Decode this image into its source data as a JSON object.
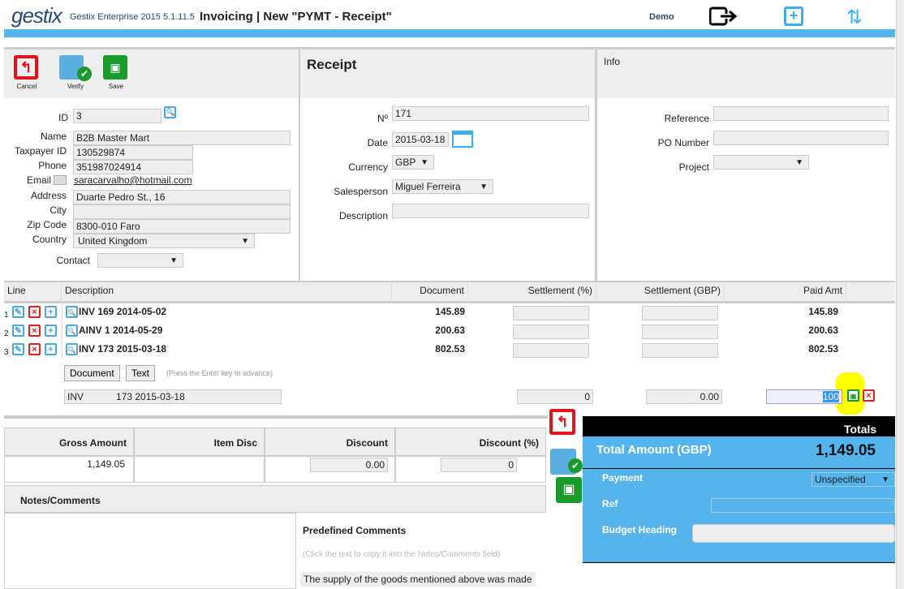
{
  "header": {
    "logo": "gestix",
    "app": "Gestix Enterprise 2015 5.1.11.5",
    "title": "Invoicing | New \"PYMT - Receipt\"",
    "user": "Demo"
  },
  "toolbar": {
    "cancel": "Cancel",
    "verify": "Verify",
    "save": "Save"
  },
  "customer": {
    "id_label": "ID",
    "id": "3",
    "name_label": "Name",
    "name": "B2B Master Mart",
    "tax_label": "Taxpayer ID",
    "tax": "130529874",
    "phone_label": "Phone",
    "phone": "351987024914",
    "email_label": "Email",
    "email": "saracarvalho@hotmail.com",
    "address_label": "Address",
    "address": "Duarte Pedro St., 16",
    "city_label": "City",
    "city": "",
    "zip_label": "Zip Code",
    "zip": "8300-010 Faro",
    "country_label": "Country",
    "country": "United Kingdom",
    "contact_label": "Contact",
    "contact": ""
  },
  "receipt": {
    "title": "Receipt",
    "no_label": "Nº",
    "no": "171",
    "date_label": "Date",
    "date": "2015-03-18",
    "currency_label": "Currency",
    "currency": "GBP",
    "salesperson_label": "Salesperson",
    "salesperson": "Miguel Ferreira",
    "description_label": "Description",
    "description": ""
  },
  "info": {
    "title": "Info",
    "reference_label": "Reference",
    "reference": "",
    "po_label": "PO Number",
    "po": "",
    "project_label": "Project",
    "project": ""
  },
  "lines": {
    "headers": [
      "Line",
      "Description",
      "Document",
      "Settlement (%)",
      "Settlement (GBP)",
      "Paid Amt"
    ],
    "rows": [
      {
        "n": "1",
        "desc": "INV 169 2014-05-02",
        "doc": "145.89",
        "paid": "145.89"
      },
      {
        "n": "2",
        "desc": "AINV 1 2014-05-29",
        "doc": "200.63",
        "paid": "200.63"
      },
      {
        "n": "3",
        "desc": "INV 173 2015-03-18",
        "doc": "802.53",
        "paid": "802.53"
      }
    ],
    "document_btn": "Document",
    "text_btn": "Text",
    "hint": "(Press the Enter key to advance)",
    "edit": {
      "type": "INV",
      "doc": "173 2015-03-18",
      "pct": "0",
      "gbp": "0.00",
      "paid": "100"
    }
  },
  "discounts": {
    "headers": [
      "Gross Amount",
      "Item Disc",
      "Discount",
      "Discount (%)"
    ],
    "gross": "1,149.05",
    "item": "",
    "discount": "0.00",
    "pct": "0"
  },
  "notes": {
    "title": "Notes/Comments",
    "predef_title": "Predefined Comments",
    "predef_hint": "(Click the text to copy it into the Notes/Comments field)",
    "predef_item": "The supply of the goods mentioned above was made"
  },
  "totals": {
    "title": "Totals",
    "total_label": "Total Amount (GBP)",
    "total": "1,149.05",
    "payment_label": "Payment",
    "payment": "Unspecified",
    "ref_label": "Ref",
    "ref": "",
    "budget_label": "Budget Heading",
    "budget": ""
  },
  "colors": {
    "accent": "#55b4ec",
    "cancel": "#e0141a",
    "save": "#1a9a2a",
    "highlight": "#ffff00"
  }
}
